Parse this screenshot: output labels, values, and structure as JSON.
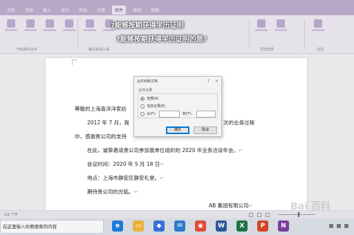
{
  "overlay": {
    "title_line1": "?能够按期获得学历证明",
    "title_line2": "?能够按期获得学历证明的是?"
  },
  "ribbon": {
    "tabs": [
      "文件",
      "开始",
      "插入",
      "设计",
      "布局",
      "引用",
      "邮件",
      "审阅",
      "视图"
    ],
    "group_labels": [
      "开始邮件合并",
      "编写和插入域",
      "预览结果",
      "完成"
    ]
  },
  "dialog": {
    "title": "合并到新文档",
    "help": "?",
    "close": "×",
    "group_label": "合并记录",
    "options": [
      {
        "label": "全部(A)",
        "checked": true
      },
      {
        "label": "当前记录(E)",
        "checked": false
      },
      {
        "label": "从(F):",
        "checked": false
      }
    ],
    "to_label": "到(T):",
    "ok": "确定",
    "cancel": "取消"
  },
  "document": {
    "greeting": "尊敬的上海喜洋洋家纺",
    "p1_start": "2012 年 7 月，我",
    "p1_end": "0 次的业务过程",
    "p2": "中，感谢贵公司的支持",
    "p3": "在此，诚挚邀请贵公司参加我单位组织的 2020 年业务洽谈年会。",
    "meeting_time": "会议时间：2020 年 5 月 18 日",
    "meeting_place": "地点：上海市静安区静安礼堂。",
    "closing": "期待贵公司的光临。",
    "signature": "AB 集团有限公司",
    "para_mark": "↵"
  },
  "statusbar": {
    "page_info": "1/2 个字"
  },
  "taskbar": {
    "search_placeholder": "在这里输入你要搜索的内容",
    "apps": [
      {
        "name": "edge",
        "glyph": "e",
        "color": "#1f7ad6"
      },
      {
        "name": "explorer",
        "glyph": "▭",
        "color": "#e9b23a"
      },
      {
        "name": "store",
        "glyph": "◆",
        "color": "#3a6fd8"
      },
      {
        "name": "mail",
        "glyph": "✉",
        "color": "#2b79c9"
      },
      {
        "name": "chrome",
        "glyph": "◉",
        "color": "#e14a3a"
      },
      {
        "name": "word",
        "glyph": "W",
        "color": "#2b5797"
      },
      {
        "name": "excel",
        "glyph": "X",
        "color": "#1f7244"
      },
      {
        "name": "powerpoint",
        "glyph": "P",
        "color": "#d04423"
      },
      {
        "name": "onenote",
        "glyph": "N",
        "color": "#7a3d9e"
      }
    ]
  },
  "watermark": {
    "text": "Bai 百科"
  },
  "zoom": {
    "level_fraction": 0.55
  }
}
